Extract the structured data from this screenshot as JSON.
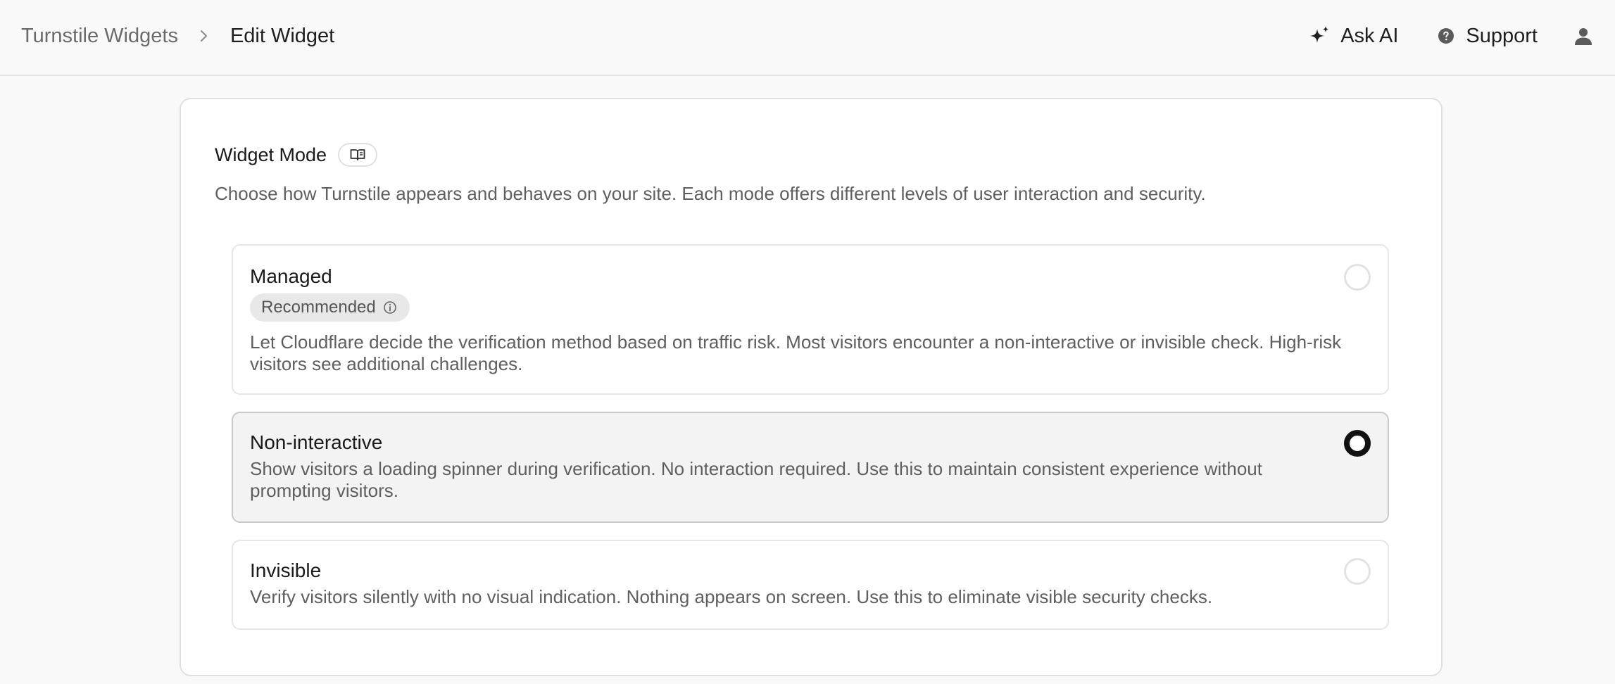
{
  "breadcrumb": {
    "parent": "Turnstile Widgets",
    "current": "Edit Widget"
  },
  "header": {
    "ask_ai_label": "Ask AI",
    "support_label": "Support",
    "icons": {
      "ask_ai": "sparkle-icon",
      "support": "help-circle-icon",
      "user": "user-icon",
      "separator": "chevron-right-icon"
    }
  },
  "widget_mode": {
    "title": "Widget Mode",
    "docs_icon": "book-icon",
    "description": "Choose how Turnstile appears and behaves on your site. Each mode offers different levels of user interaction and security.",
    "selected": "Non-interactive",
    "options": [
      {
        "title": "Managed",
        "badge": "Recommended",
        "badge_icon": "info-icon",
        "description": "Let Cloudflare decide the verification method based on traffic risk. Most visitors encounter a non-interactive or invisible check. High-risk visitors see additional challenges.",
        "selected": false
      },
      {
        "title": "Non-interactive",
        "description": "Show visitors a loading spinner during verification. No interaction required. Use this to maintain consistent experience without prompting visitors.",
        "selected": true
      },
      {
        "title": "Invisible",
        "description": "Verify visitors silently with no visual indication. Nothing appears on screen. Use this to eliminate visible security checks.",
        "selected": false
      }
    ]
  },
  "colors": {
    "background": "#f9f9f9",
    "card": "#ffffff",
    "selected_option_bg": "#f3f3f3",
    "muted_text": "#5f5f5f",
    "radio_selected": "#111111"
  }
}
